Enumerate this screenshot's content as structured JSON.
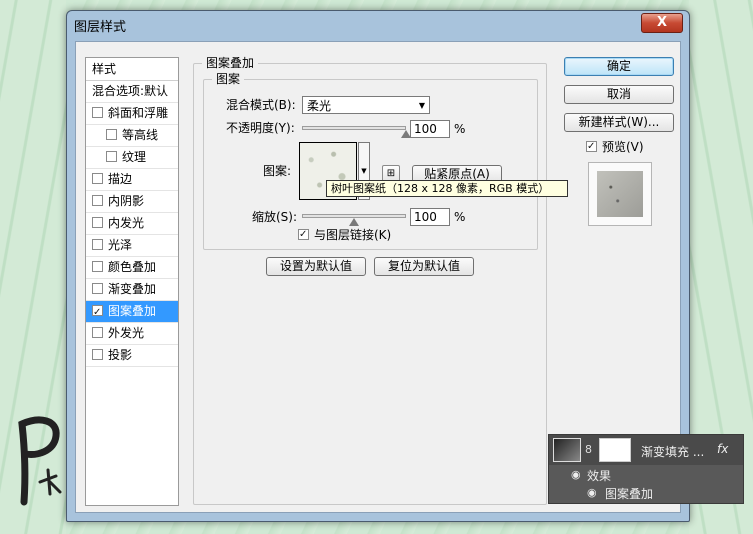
{
  "window": {
    "title": "图层样式",
    "close_glyph": "X"
  },
  "style_list": {
    "header": "样式",
    "items": [
      {
        "label": "混合选项:默认",
        "checkbox": false,
        "checked": false,
        "indent": false,
        "active": false
      },
      {
        "label": "斜面和浮雕",
        "checkbox": true,
        "checked": false,
        "indent": false,
        "active": false
      },
      {
        "label": "等高线",
        "checkbox": true,
        "checked": false,
        "indent": true,
        "active": false
      },
      {
        "label": "纹理",
        "checkbox": true,
        "checked": false,
        "indent": true,
        "active": false
      },
      {
        "label": "描边",
        "checkbox": true,
        "checked": false,
        "indent": false,
        "active": false
      },
      {
        "label": "内阴影",
        "checkbox": true,
        "checked": false,
        "indent": false,
        "active": false
      },
      {
        "label": "内发光",
        "checkbox": true,
        "checked": false,
        "indent": false,
        "active": false
      },
      {
        "label": "光泽",
        "checkbox": true,
        "checked": false,
        "indent": false,
        "active": false
      },
      {
        "label": "颜色叠加",
        "checkbox": true,
        "checked": false,
        "indent": false,
        "active": false
      },
      {
        "label": "渐变叠加",
        "checkbox": true,
        "checked": false,
        "indent": false,
        "active": false
      },
      {
        "label": "图案叠加",
        "checkbox": true,
        "checked": true,
        "indent": false,
        "active": true
      },
      {
        "label": "外发光",
        "checkbox": true,
        "checked": false,
        "indent": false,
        "active": false
      },
      {
        "label": "投影",
        "checkbox": true,
        "checked": false,
        "indent": false,
        "active": false
      }
    ]
  },
  "pattern_overlay": {
    "group_title": "图案叠加",
    "subgroup_title": "图案",
    "blend_mode_label": "混合模式(B):",
    "blend_mode_value": "柔光",
    "opacity_label": "不透明度(Y):",
    "opacity_value": "100",
    "opacity_fraction": 1.0,
    "opacity_unit": "%",
    "pattern_label": "图案:",
    "snap_button": "贴紧原点(A)",
    "tooltip": "树叶图案纸（128 x 128 像素，RGB 模式）",
    "scale_label": "缩放(S):",
    "scale_value": "100",
    "scale_fraction": 0.5,
    "scale_unit": "%",
    "link_label": "与图层链接(K)",
    "link_checked": true,
    "set_default_button": "设置为默认值",
    "reset_default_button": "复位为默认值"
  },
  "actions": {
    "ok": "确定",
    "cancel": "取消",
    "new_style": "新建样式(W)...",
    "preview_label": "预览(V)",
    "preview_checked": true
  },
  "layers_panel": {
    "layer_name": "渐变填充 ...",
    "fx_label": "fx",
    "effects_label": "效果",
    "effect_item": "图案叠加"
  },
  "colors": {
    "selection": "#3399ff",
    "window_frame": "#a8c3dc",
    "layers_bg": "#595959"
  }
}
